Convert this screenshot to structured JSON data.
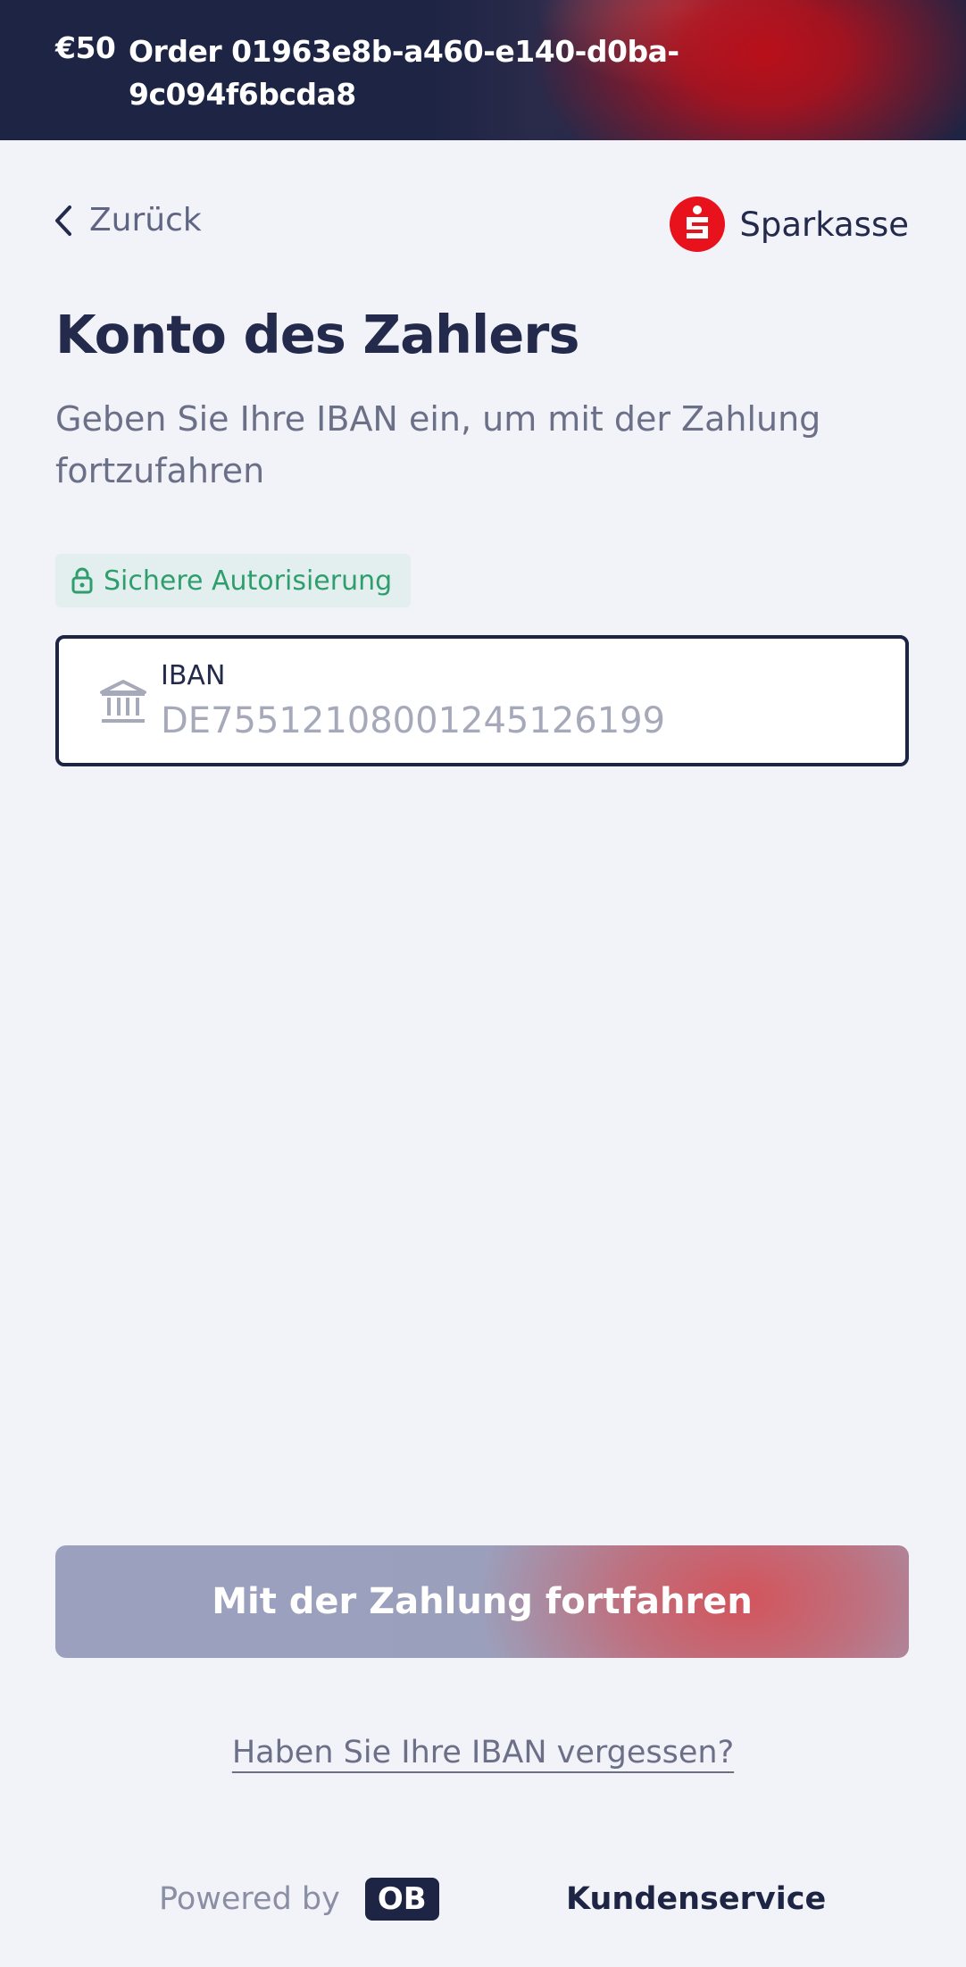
{
  "header": {
    "amount": "€50",
    "order_label": "Order 01963e8b-a460-e140-d0ba-9c094f6bcda8"
  },
  "nav": {
    "back_label": "Zurück",
    "bank_name": "Sparkasse"
  },
  "main": {
    "title": "Konto des Zahlers",
    "subtitle": "Geben Sie Ihre IBAN ein, um mit der Zahlung fortzufahren",
    "secure_badge": "Sichere Autorisierung",
    "iban_field": {
      "label": "IBAN",
      "value": "",
      "placeholder": "DE75512108001245126199"
    },
    "continue_button": "Mit der Zahlung fortfahren",
    "forgot_link": "Haben Sie Ihre IBAN vergessen?"
  },
  "footer": {
    "powered_by": "Powered by",
    "provider_logo": "OB",
    "support_link": "Kundenservice"
  },
  "colors": {
    "primary_dark": "#1d2444",
    "bank_red": "#e8121c",
    "secure_green": "#2f9e6e",
    "background": "#f2f3f8"
  },
  "icons": {
    "back": "chevron-left-icon",
    "bank_logo": "sparkasse-logo-icon",
    "secure": "lock-icon",
    "iban": "bank-building-icon"
  }
}
